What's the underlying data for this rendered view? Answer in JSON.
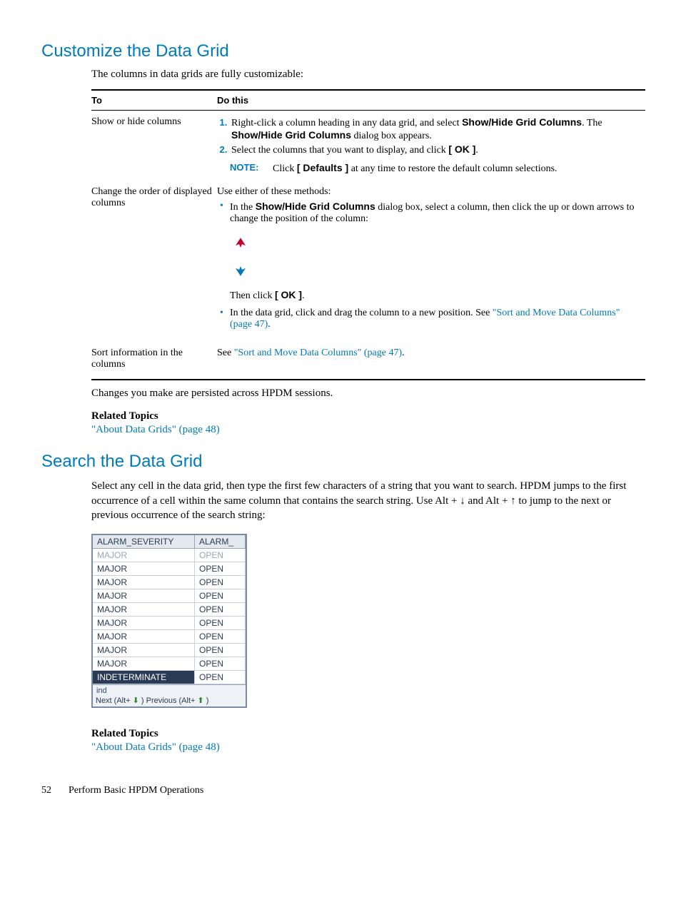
{
  "section1": {
    "heading": "Customize the Data Grid",
    "intro": "The columns in data grids are fully customizable:",
    "table": {
      "h1": "To",
      "h2": "Do this",
      "row1": {
        "to": "Show or hide columns",
        "step1a": "Right-click a column heading in any data grid, and select ",
        "step1b": "Show/Hide Grid Columns",
        "step1c": ". The ",
        "step1d": "Show/Hide Grid Columns",
        "step1e": " dialog box appears.",
        "step2a": "Select the columns that you want to display, and click ",
        "step2b": "[ OK ]",
        "step2c": ".",
        "noteLabel": "NOTE:",
        "noteA": "Click ",
        "noteB": "[ Defaults ]",
        "noteC": " at any time to restore the default column selections."
      },
      "row2": {
        "to": "Change the order of displayed columns",
        "lead": "Use either of these methods:",
        "b1a": "In the ",
        "b1b": "Show/Hide Grid Columns",
        "b1c": " dialog box, select a column, then click the up or down arrows to change the position of the column:",
        "thenA": "Then click ",
        "thenB": "[ OK ]",
        "thenC": ".",
        "b2a": "In the data grid, click and drag the column to a new position. See ",
        "b2b": "\"Sort and Move Data Columns\" (page 47)",
        "b2c": "."
      },
      "row3": {
        "to": "Sort information in the columns",
        "doA": "See ",
        "doB": "\"Sort and Move Data Columns\" (page 47)",
        "doC": "."
      }
    },
    "afterTable": "Changes you make are persisted across HPDM sessions.",
    "relatedHeading": "Related Topics",
    "relatedLink": "\"About Data Grids\" (page 48)"
  },
  "section2": {
    "heading": "Search the Data Grid",
    "body": "Select any cell in the data grid, then type the first few characters of a string that you want to search. HPDM jumps to the first occurrence of a cell within the same column that contains the search string. Use Alt + ↓ and Alt + ↑ to jump to the next or previous occurrence of the search string:",
    "miniGrid": {
      "h1": "ALARM_SEVERITY",
      "h2": "ALARM_",
      "rows": [
        {
          "c1": "MAJOR",
          "c2": "OPEN",
          "first": true
        },
        {
          "c1": "MAJOR",
          "c2": "OPEN"
        },
        {
          "c1": "MAJOR",
          "c2": "OPEN"
        },
        {
          "c1": "MAJOR",
          "c2": "OPEN"
        },
        {
          "c1": "MAJOR",
          "c2": "OPEN"
        },
        {
          "c1": "MAJOR",
          "c2": "OPEN"
        },
        {
          "c1": "MAJOR",
          "c2": "OPEN"
        },
        {
          "c1": "MAJOR",
          "c2": "OPEN"
        },
        {
          "c1": "MAJOR",
          "c2": "OPEN"
        },
        {
          "c1": "INDETERMINATE",
          "c2": "OPEN",
          "selected": true
        }
      ],
      "typed": "ind",
      "navA": "Next (Alt+ ",
      "navB": " ) Previous (Alt+ ",
      "navC": " )"
    },
    "relatedHeading": "Related Topics",
    "relatedLink": "\"About Data Grids\" (page 48)"
  },
  "footer": {
    "page": "52",
    "title": "Perform Basic HPDM Operations"
  }
}
